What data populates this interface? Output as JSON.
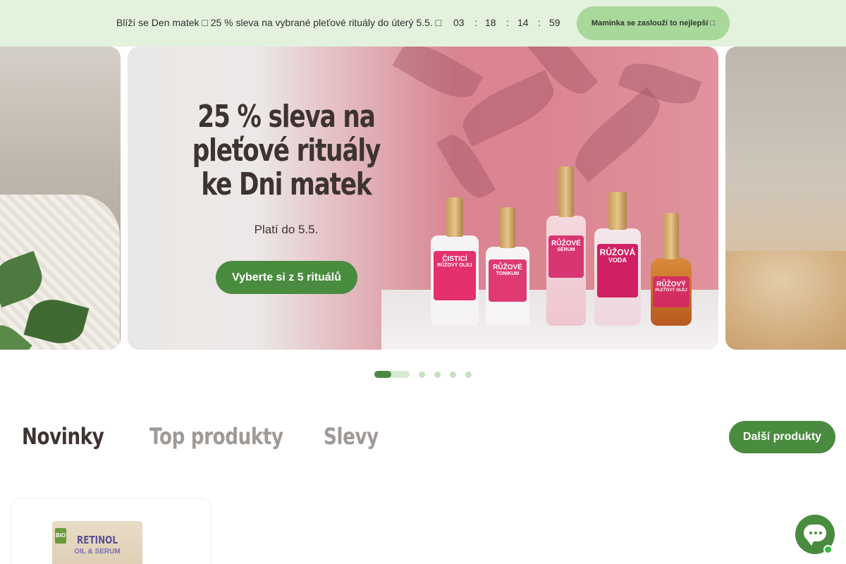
{
  "announcement": {
    "text": "Blíží se Den matek □ 25 % sleva na vybrané pleťové rituály do úterý 5.5. □",
    "countdown": {
      "days": "03",
      "hours": "18",
      "minutes": "14",
      "seconds": "59",
      "separator": ":"
    },
    "button_label": "Maminka se zaslouží to nejlepší □"
  },
  "hero": {
    "title": "25 % sleva na pleťové rituály ke Dni matek",
    "subtitle": "Platí do 5.5.",
    "cta_label": "Vyberte si z 5 rituálů",
    "bottles": [
      {
        "line1": "ČISTICÍ",
        "line2": "RŮŽOVÝ OLEJ"
      },
      {
        "line1": "RŮŽOVÉ",
        "line2": "TONIKUM"
      },
      {
        "line1": "RŮŽOVÉ",
        "line2": "SÉRUM"
      },
      {
        "line1": "RŮŽOVÁ",
        "line2": "VODA"
      },
      {
        "line1": "RŮŽOVÝ",
        "line2": "PLEŤOVÝ OLEJ"
      }
    ],
    "slides_total": 5,
    "slide_active": 1
  },
  "tabs": [
    {
      "label": "Novinky",
      "active": true
    },
    {
      "label": "Top produkty",
      "active": false
    },
    {
      "label": "Slevy",
      "active": false
    }
  ],
  "more_products_label": "Další produkty",
  "product_card": {
    "box_title": "RETINOL",
    "box_sub": "OIL & SERUM",
    "badge": "BIO"
  },
  "colors": {
    "brand_green": "#4a8c3f",
    "topbar_bg": "#e3f2dc",
    "topbar_button": "#a9d89b",
    "text_dark": "#3d3330",
    "tab_inactive": "#a09a97"
  },
  "icons": {
    "chat": "chat-bubble-icon",
    "online_status": "online-dot-icon"
  }
}
